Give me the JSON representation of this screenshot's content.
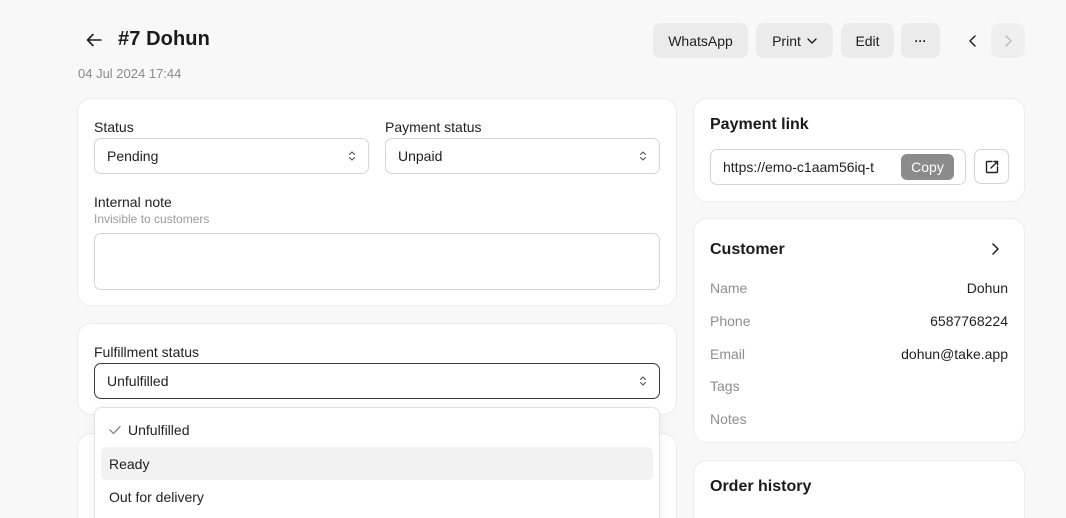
{
  "header": {
    "title": "#7 Dohun",
    "date": "04 Jul 2024 17:44",
    "whatsapp_label": "WhatsApp",
    "print_label": "Print",
    "edit_label": "Edit",
    "more_label": "···"
  },
  "order_form": {
    "status_label": "Status",
    "status_value": "Pending",
    "payment_status_label": "Payment status",
    "payment_status_value": "Unpaid",
    "internal_note_label": "Internal note",
    "internal_note_hint": "Invisible to customers",
    "internal_note_value": ""
  },
  "fulfillment": {
    "label": "Fulfillment status",
    "value": "Unfulfilled",
    "options": [
      {
        "label": "Unfulfilled",
        "selected": true
      },
      {
        "label": "Ready",
        "highlighted": true
      },
      {
        "label": "Out for delivery"
      }
    ]
  },
  "payment_link": {
    "title": "Payment link",
    "url": "https://emo-c1aam56iq-t",
    "copy_label": "Copy"
  },
  "customer": {
    "title": "Customer",
    "fields": [
      {
        "key": "Name",
        "value": "Dohun"
      },
      {
        "key": "Phone",
        "value": "6587768224"
      },
      {
        "key": "Email",
        "value": "dohun@take.app"
      },
      {
        "key": "Tags",
        "value": ""
      },
      {
        "key": "Notes",
        "value": ""
      }
    ]
  },
  "order_history": {
    "title": "Order history"
  },
  "colors": {
    "background": "#f8f8f8",
    "card": "#ffffff",
    "button_gray": "#ebebeb",
    "copy_button": "#8b8b8b"
  }
}
